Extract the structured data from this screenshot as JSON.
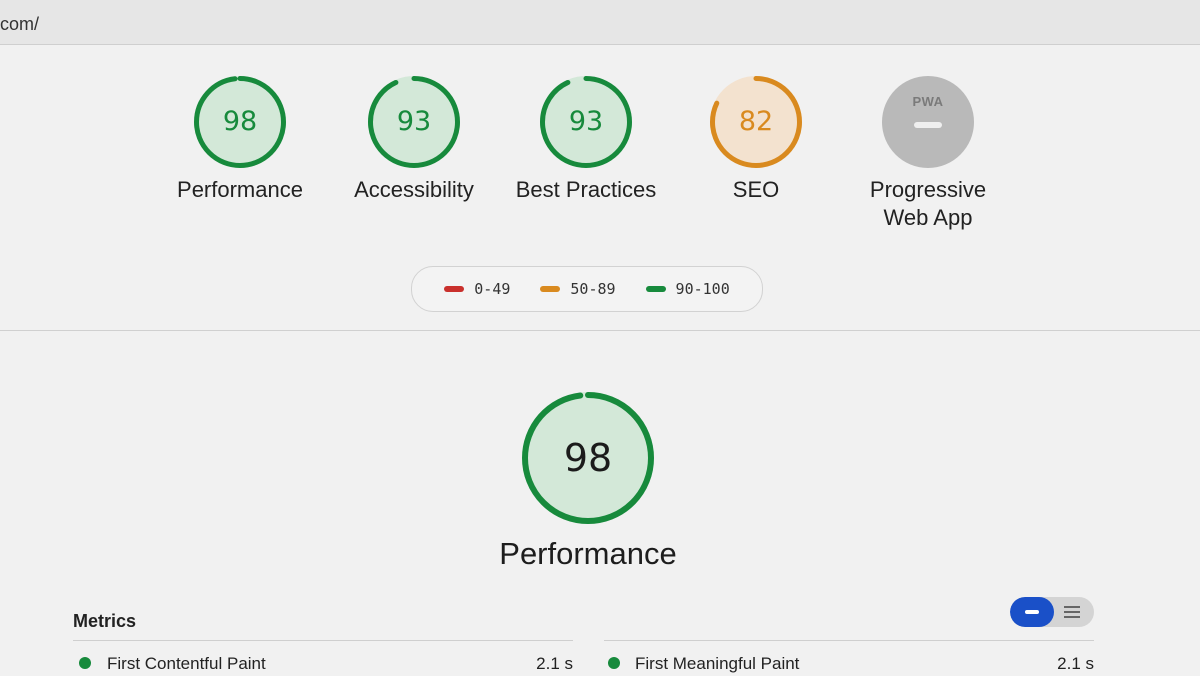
{
  "browser": {
    "url_fragment": "com/"
  },
  "colors": {
    "pass": "#178a3c",
    "pass_fill": "#d3e8d8",
    "average": "#d98a1f",
    "average_fill": "#f3e2cf",
    "fail": "#c9302c",
    "na": "#b9b9b9"
  },
  "categories": [
    {
      "label": "Performance",
      "score": "98",
      "fraction": 0.98,
      "rating": "pass"
    },
    {
      "label": "Accessibility",
      "score": "93",
      "fraction": 0.93,
      "rating": "pass"
    },
    {
      "label": "Best Practices",
      "score": "93",
      "fraction": 0.93,
      "rating": "pass"
    },
    {
      "label": "SEO",
      "score": "82",
      "fraction": 0.82,
      "rating": "average"
    },
    {
      "label_line1": "Progressive",
      "label_line2": "Web App",
      "badge": "PWA",
      "rating": "na"
    }
  ],
  "legend": [
    {
      "range": "0-49",
      "rating": "fail"
    },
    {
      "range": "50-89",
      "rating": "average"
    },
    {
      "range": "90-100",
      "rating": "pass"
    }
  ],
  "performance_section": {
    "score": "98",
    "fraction": 0.98,
    "label": "Performance"
  },
  "metrics": {
    "title": "Metrics",
    "view_toggle": {
      "selected": "compact"
    },
    "items": [
      {
        "name": "First Contentful Paint",
        "value": "2.1 s",
        "rating": "pass"
      },
      {
        "name": "First Meaningful Paint",
        "value": "2.1 s",
        "rating": "pass"
      }
    ]
  }
}
